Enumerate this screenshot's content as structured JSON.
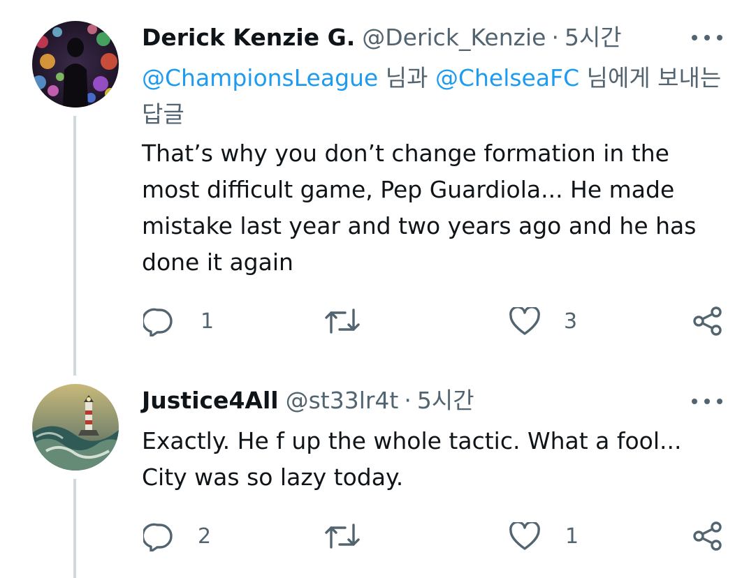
{
  "tweets": [
    {
      "name": "Derick Kenzie G.",
      "handle": "@Derick_Kenzie",
      "separator": "·",
      "time": "5시간",
      "reply_mention_1": "@ChampionsLeague",
      "reply_and": " 님과 ",
      "reply_mention_2": "@ChelseaFC",
      "reply_suffix": " 님에게 보내는 답글",
      "text": "That’s why you don’t change formation in the most difficult game, Pep Guardiola... He made mistake last year and two years ago and he has done it again",
      "reply_count": "1",
      "retweet_count": "",
      "like_count": "3"
    },
    {
      "name": "Justice4All",
      "handle": "@st33lr4t",
      "separator": "·",
      "time": "5시간",
      "text": "Exactly. He f up the whole tactic. What a fool... City was so lazy today.",
      "reply_count": "2",
      "retweet_count": "",
      "like_count": "1"
    }
  ],
  "icons": {
    "reply": "reply-icon",
    "retweet": "retweet-icon",
    "like": "heart-icon",
    "share": "share-icon",
    "more": "more-icon"
  },
  "colors": {
    "text": "#0f1419",
    "secondary": "#536471",
    "mention": "#1d9bf0",
    "thread_line": "#cfd9de"
  }
}
